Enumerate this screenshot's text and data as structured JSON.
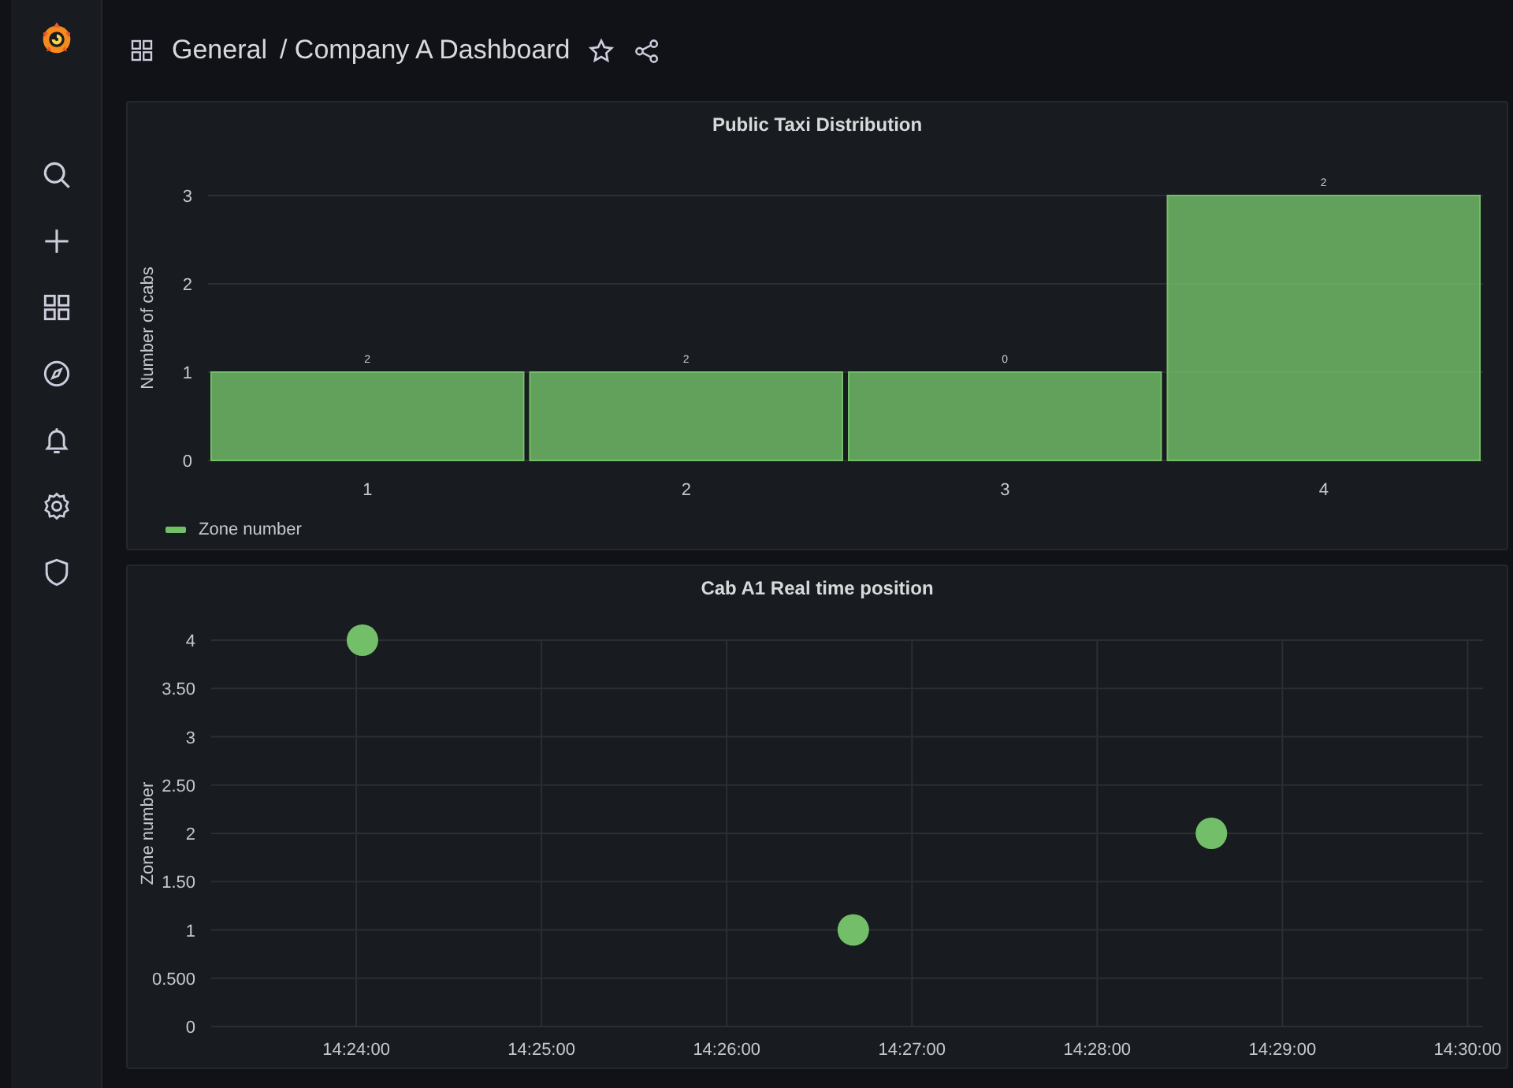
{
  "header": {
    "folder": "General",
    "title": "/ Company A Dashboard"
  },
  "panels": [
    {
      "title": "Public Taxi Distribution",
      "chart_data": {
        "type": "bar",
        "ylabel": "Number of cabs",
        "categories": [
          "1",
          "2",
          "3",
          "4"
        ],
        "series": [
          {
            "name": "Zone number",
            "color": "#73bf69",
            "values": [
              1,
              1,
              1,
              3
            ]
          }
        ],
        "ylim": [
          0,
          3
        ],
        "yticks": [
          0,
          1,
          2,
          3
        ],
        "value_labels": [
          "2",
          "2",
          "0",
          "2"
        ]
      }
    },
    {
      "title": "Cab A1 Real time position",
      "chart_data": {
        "type": "scatter",
        "ylabel": "Zone number",
        "grid": true,
        "x": [
          51842,
          52001,
          52117
        ],
        "series": [
          {
            "color": "#73bf69",
            "values": [
              4,
              1,
              2
            ]
          }
        ],
        "xlim": [
          51793,
          52205
        ],
        "ylim": [
          0,
          4
        ],
        "xticks": [
          {
            "value": 51840,
            "label": "14:24:00"
          },
          {
            "value": 51900,
            "label": "14:25:00"
          },
          {
            "value": 51960,
            "label": "14:26:00"
          },
          {
            "value": 52020,
            "label": "14:27:00"
          },
          {
            "value": 52080,
            "label": "14:28:00"
          },
          {
            "value": 52140,
            "label": "14:29:00"
          },
          {
            "value": 52200,
            "label": "14:30:00"
          }
        ],
        "yticks": [
          {
            "value": 0,
            "label": "0"
          },
          {
            "value": 0.5,
            "label": "0.500"
          },
          {
            "value": 1,
            "label": "1"
          },
          {
            "value": 1.5,
            "label": "1.50"
          },
          {
            "value": 2,
            "label": "2"
          },
          {
            "value": 2.5,
            "label": "2.50"
          },
          {
            "value": 3,
            "label": "3"
          },
          {
            "value": 3.5,
            "label": "3.50"
          },
          {
            "value": 4,
            "label": "4"
          }
        ]
      }
    }
  ]
}
